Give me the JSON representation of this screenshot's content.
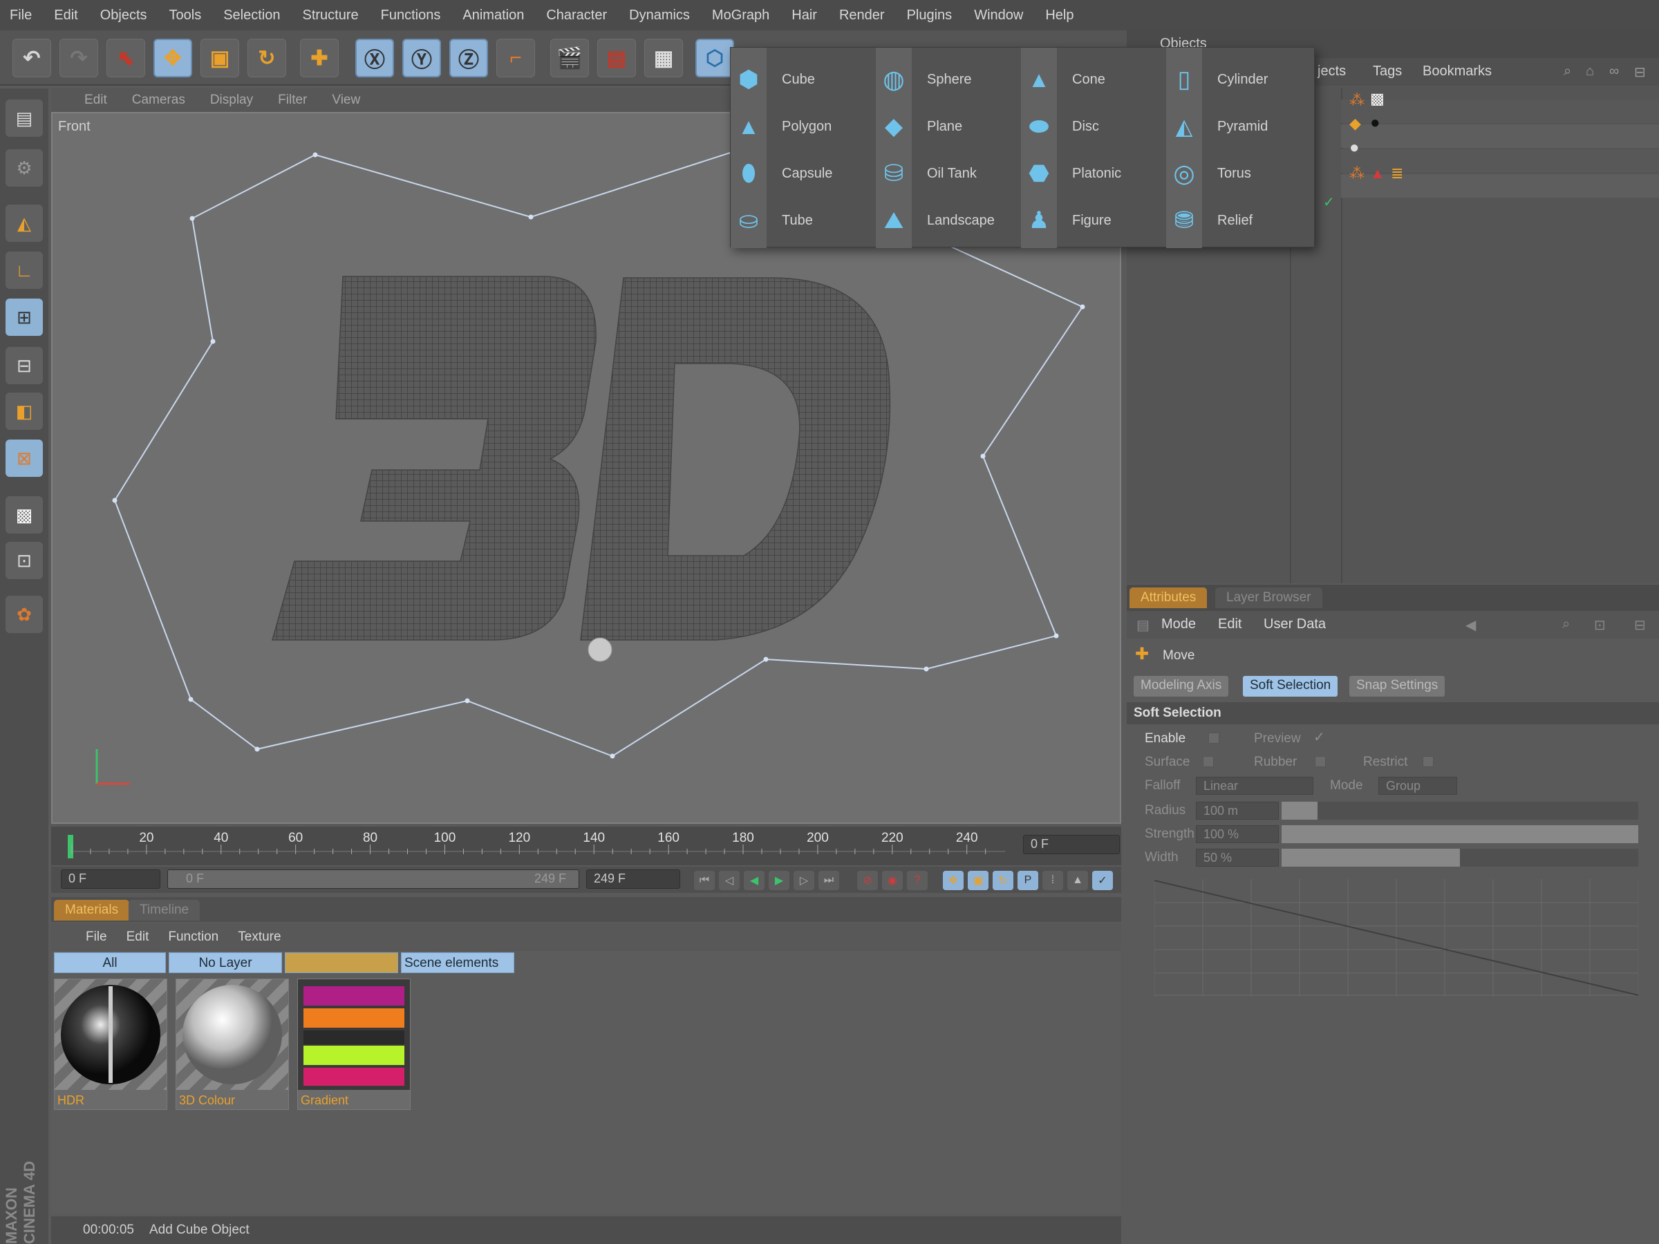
{
  "menubar": [
    "File",
    "Edit",
    "Objects",
    "Tools",
    "Selection",
    "Structure",
    "Functions",
    "Animation",
    "Character",
    "Dynamics",
    "MoGraph",
    "Hair",
    "Render",
    "Plugins",
    "Window",
    "Help"
  ],
  "object_dropdown": {
    "items": [
      [
        "Cube",
        "Sphere",
        "Cone",
        "Cylinder"
      ],
      [
        "Polygon",
        "Plane",
        "Disc",
        "Pyramid"
      ],
      [
        "Capsule",
        "Oil Tank",
        "Platonic",
        "Torus"
      ],
      [
        "Tube",
        "Landscape",
        "Figure",
        "Relief"
      ]
    ]
  },
  "viewport": {
    "menu": [
      "Edit",
      "Cameras",
      "Display",
      "Filter",
      "View"
    ],
    "label": "Front"
  },
  "timeline": {
    "ticks": [
      "20",
      "40",
      "60",
      "80",
      "100",
      "120",
      "140",
      "160",
      "180",
      "200",
      "220",
      "240"
    ],
    "current_frame": "0 F",
    "start_frame": "0 F",
    "range_start": "0 F",
    "range_end": "249 F",
    "end_frame": "249 F"
  },
  "materials": {
    "tabs": [
      "Materials",
      "Timeline"
    ],
    "menu": [
      "File",
      "Edit",
      "Function",
      "Texture"
    ],
    "layer_tabs": [
      "All",
      "No Layer",
      "",
      "Scene elements"
    ],
    "items": [
      "HDR",
      "3D Colour",
      "Gradient"
    ]
  },
  "status": {
    "time": "00:00:05",
    "message": "Add Cube Object"
  },
  "brand": "MAXON CINEMA 4D",
  "objects_panel": {
    "title": "Objects",
    "tabs": [
      "jects",
      "Tags",
      "Bookmarks"
    ]
  },
  "attributes": {
    "tabs": [
      "Attributes",
      "Layer Browser"
    ],
    "menu": [
      "Mode",
      "Edit",
      "User Data"
    ],
    "tool": "Move",
    "sub_tabs": [
      "Modeling Axis",
      "Soft Selection",
      "Snap Settings"
    ],
    "section": "Soft Selection",
    "enable_label": "Enable",
    "preview_label": "Preview",
    "surface_label": "Surface",
    "rubber_label": "Rubber",
    "restrict_label": "Restrict",
    "falloff_label": "Falloff",
    "falloff_value": "Linear",
    "mode_label": "Mode",
    "mode_value": "Group",
    "radius_label": "Radius",
    "radius_value": "100 m",
    "radius_level": 0.1,
    "strength_label": "Strength",
    "strength_value": "100 %",
    "strength_level": 1.0,
    "width_label": "Width",
    "width_value": "50 %",
    "width_level": 0.5
  },
  "colors": {
    "accent_orange": "#e9a12c",
    "highlight_blue": "#8fb4d8",
    "spline": "#c9d7ec"
  }
}
